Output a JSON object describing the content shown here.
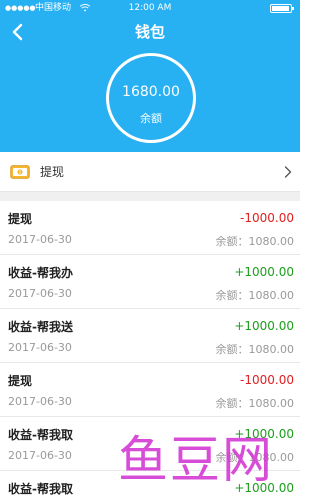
{
  "status_bar": {
    "signal": "●●●●●",
    "carrier": "中国移动",
    "time": "12:00 AM"
  },
  "nav": {
    "title": "钱包"
  },
  "balance": {
    "value": "1680.00",
    "caption": "余额"
  },
  "withdraw": {
    "label": "提现"
  },
  "transactions": [
    {
      "title": "提现",
      "amount": "-1000.00",
      "date": "2017-06-30",
      "balance": "余额：1080.00",
      "type": "negative"
    },
    {
      "title": "收益-帮我办",
      "amount": "+1000.00",
      "date": "2017-06-30",
      "balance": "余额：1080.00",
      "type": "positive"
    },
    {
      "title": "收益-帮我送",
      "amount": "+1000.00",
      "date": "2017-06-30",
      "balance": "余额：1080.00",
      "type": "positive"
    },
    {
      "title": "提现",
      "amount": "-1000.00",
      "date": "2017-06-30",
      "balance": "余额：1080.00",
      "type": "negative"
    },
    {
      "title": "收益-帮我取",
      "amount": "+1000.00",
      "date": "2017-06-30",
      "balance": "余额：1080.00",
      "type": "positive"
    },
    {
      "title": "收益-帮我取",
      "amount": "+1000.00",
      "date": "",
      "balance": "",
      "type": "positive"
    }
  ],
  "watermark": {
    "text": "鱼豆网"
  },
  "colors": {
    "header": "#27b0f2",
    "negative": "#e02020",
    "positive": "#1d9e1d",
    "watermark": "#d43ad4"
  }
}
